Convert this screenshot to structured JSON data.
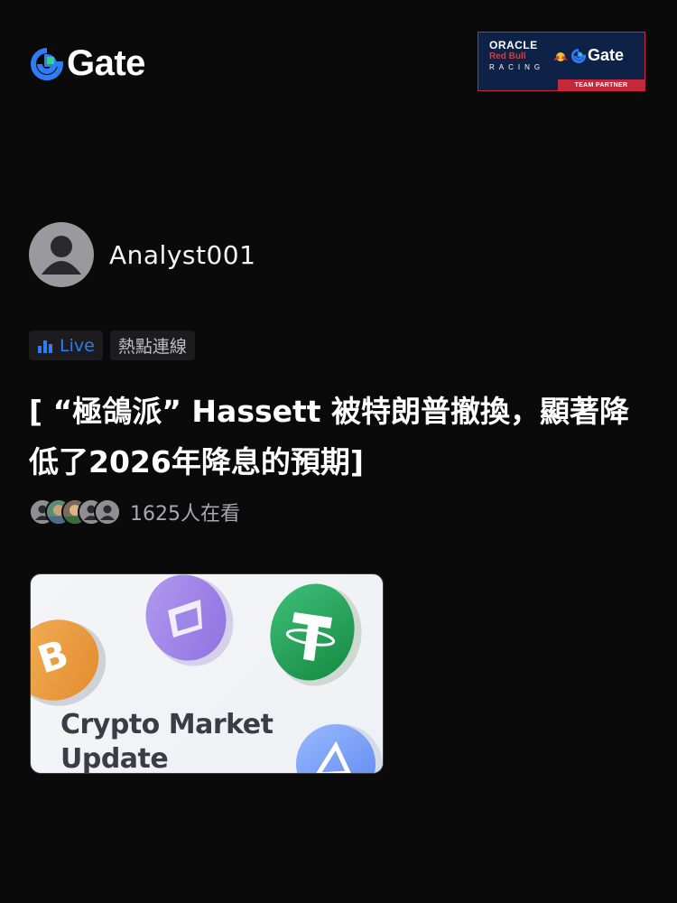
{
  "brand": {
    "name": "Gate",
    "logo_color": "#2f7df6"
  },
  "partner_badge": {
    "oracle": "ORACLE",
    "red_bull": "Red Bull",
    "racing": "RACING",
    "gate": "Gate",
    "caption": "TEAM PARTNER"
  },
  "author": {
    "name": "Analyst001",
    "avatar_icon": "user-avatar-icon"
  },
  "tags": {
    "live_label": "Live",
    "live_icon": "bar-chart-icon",
    "topic": "熱點連線"
  },
  "post": {
    "headline": "[ “極鴿派” Hassett 被特朗普撤換，顯著降低了2026年降息的預期]"
  },
  "viewers": {
    "count_text": "1625人在看"
  },
  "card": {
    "title_line1": "Crypto Market",
    "title_line2": "Update"
  }
}
